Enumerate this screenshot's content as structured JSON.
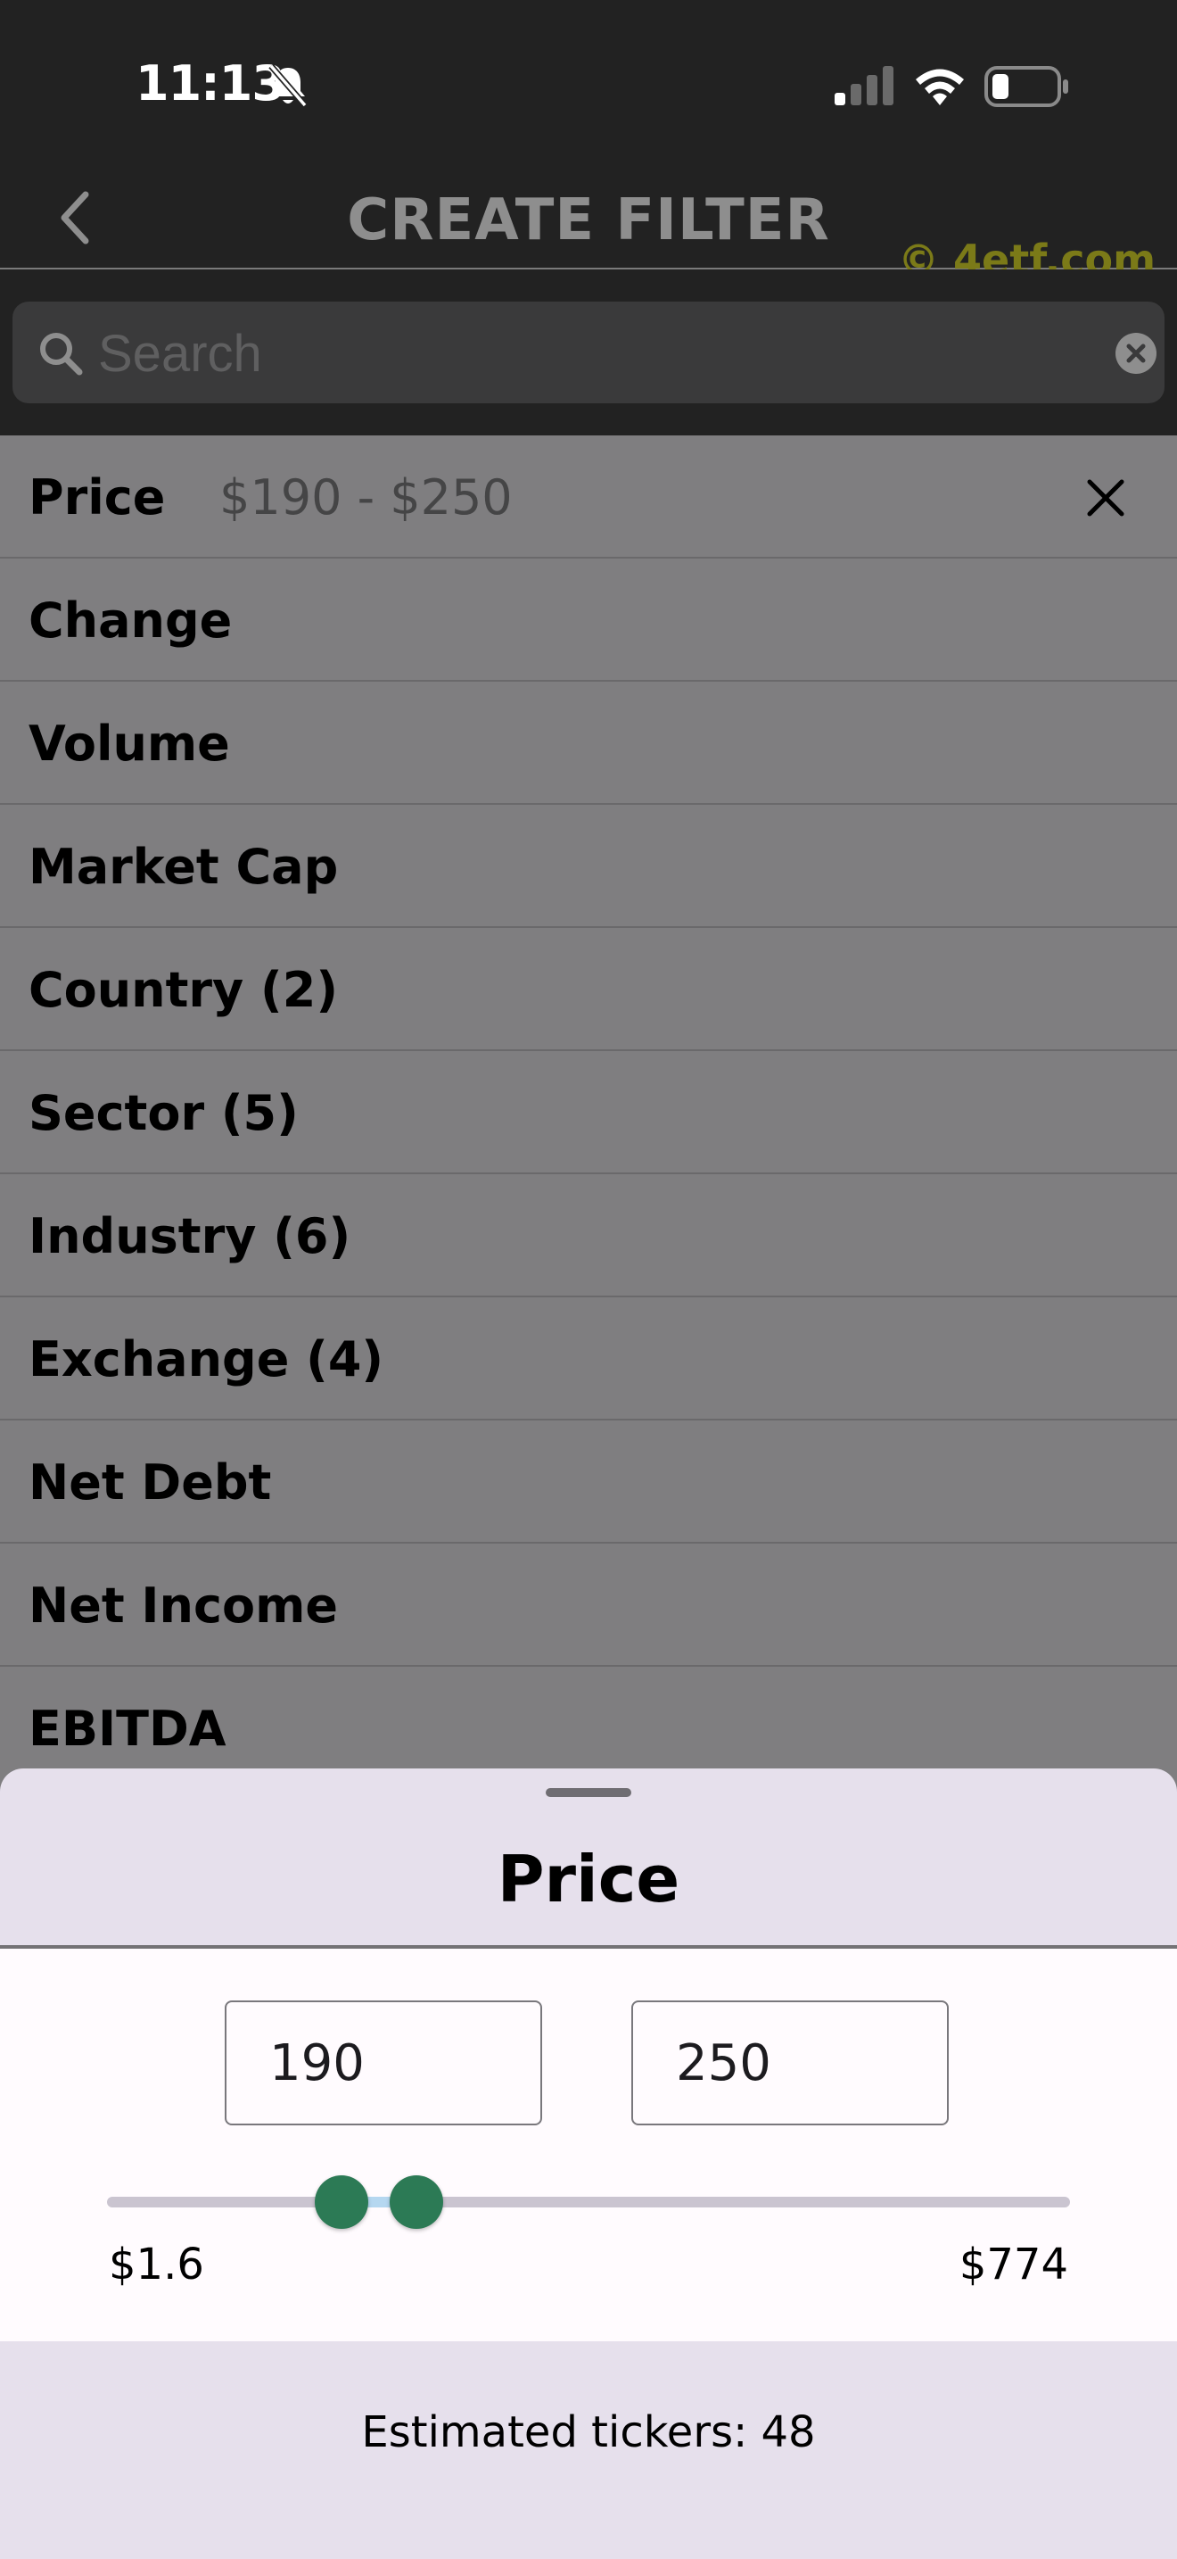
{
  "status_bar": {
    "time": "11:13",
    "icons": [
      "bell-slash-icon",
      "cellular-signal-icon",
      "wifi-icon",
      "battery-icon"
    ]
  },
  "nav": {
    "title": "CREATE FILTER",
    "back_icon": "chevron-left-icon",
    "watermark": "© 4etf.com"
  },
  "search": {
    "placeholder": "Search",
    "value": "",
    "icon": "magnifier-icon",
    "clear_icon": "clear-circle-icon"
  },
  "filters": [
    {
      "label": "Price",
      "value": "$190 - $250"
    },
    {
      "label": "Change"
    },
    {
      "label": "Volume"
    },
    {
      "label": "Market Cap"
    },
    {
      "label": "Country (2)"
    },
    {
      "label": "Sector (5)"
    },
    {
      "label": "Industry (6)"
    },
    {
      "label": "Exchange (4)"
    },
    {
      "label": "Net Debt"
    },
    {
      "label": "Net Income"
    },
    {
      "label": "EBITDA"
    }
  ],
  "sheet": {
    "title": "Price",
    "min_value": "190",
    "max_value": "250",
    "range_min_label": "$1.6",
    "range_max_label": "$774",
    "slider": {
      "min": 1.6,
      "max": 774,
      "low": 190,
      "high": 250
    },
    "estimated_tickers": "Estimated tickers: 48"
  },
  "colors": {
    "header_bg": "#222222",
    "list_bg": "#7f7e80",
    "sheet_bg": "#e6e0ec",
    "thumb": "#2c7a55",
    "watermark": "#7b7a18"
  }
}
